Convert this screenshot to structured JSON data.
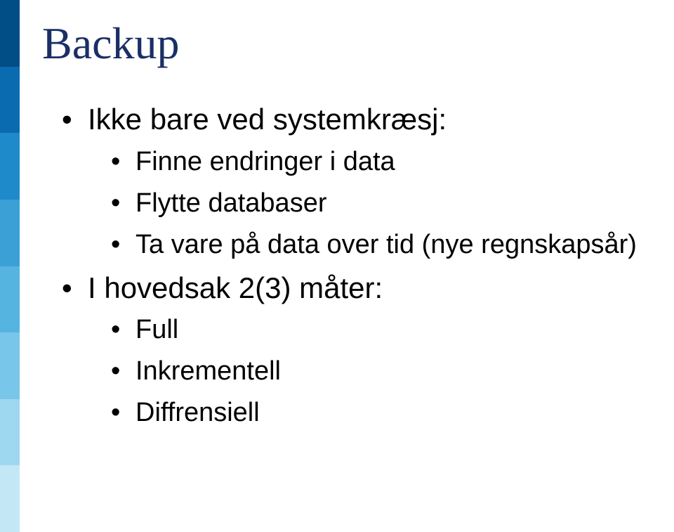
{
  "title": "Backup",
  "bullets": {
    "b1": "Ikke bare ved systemkræsj:",
    "b1_subs": {
      "s1": "Finne endringer i data",
      "s2": "Flytte databaser",
      "s3": "Ta vare på data over tid (nye regnskapsår)"
    },
    "b2": "I hovedsak 2(3) måter:",
    "b2_subs": {
      "s1": "Full",
      "s2": "Inkrementell",
      "s3": "Diffrensiell"
    }
  }
}
